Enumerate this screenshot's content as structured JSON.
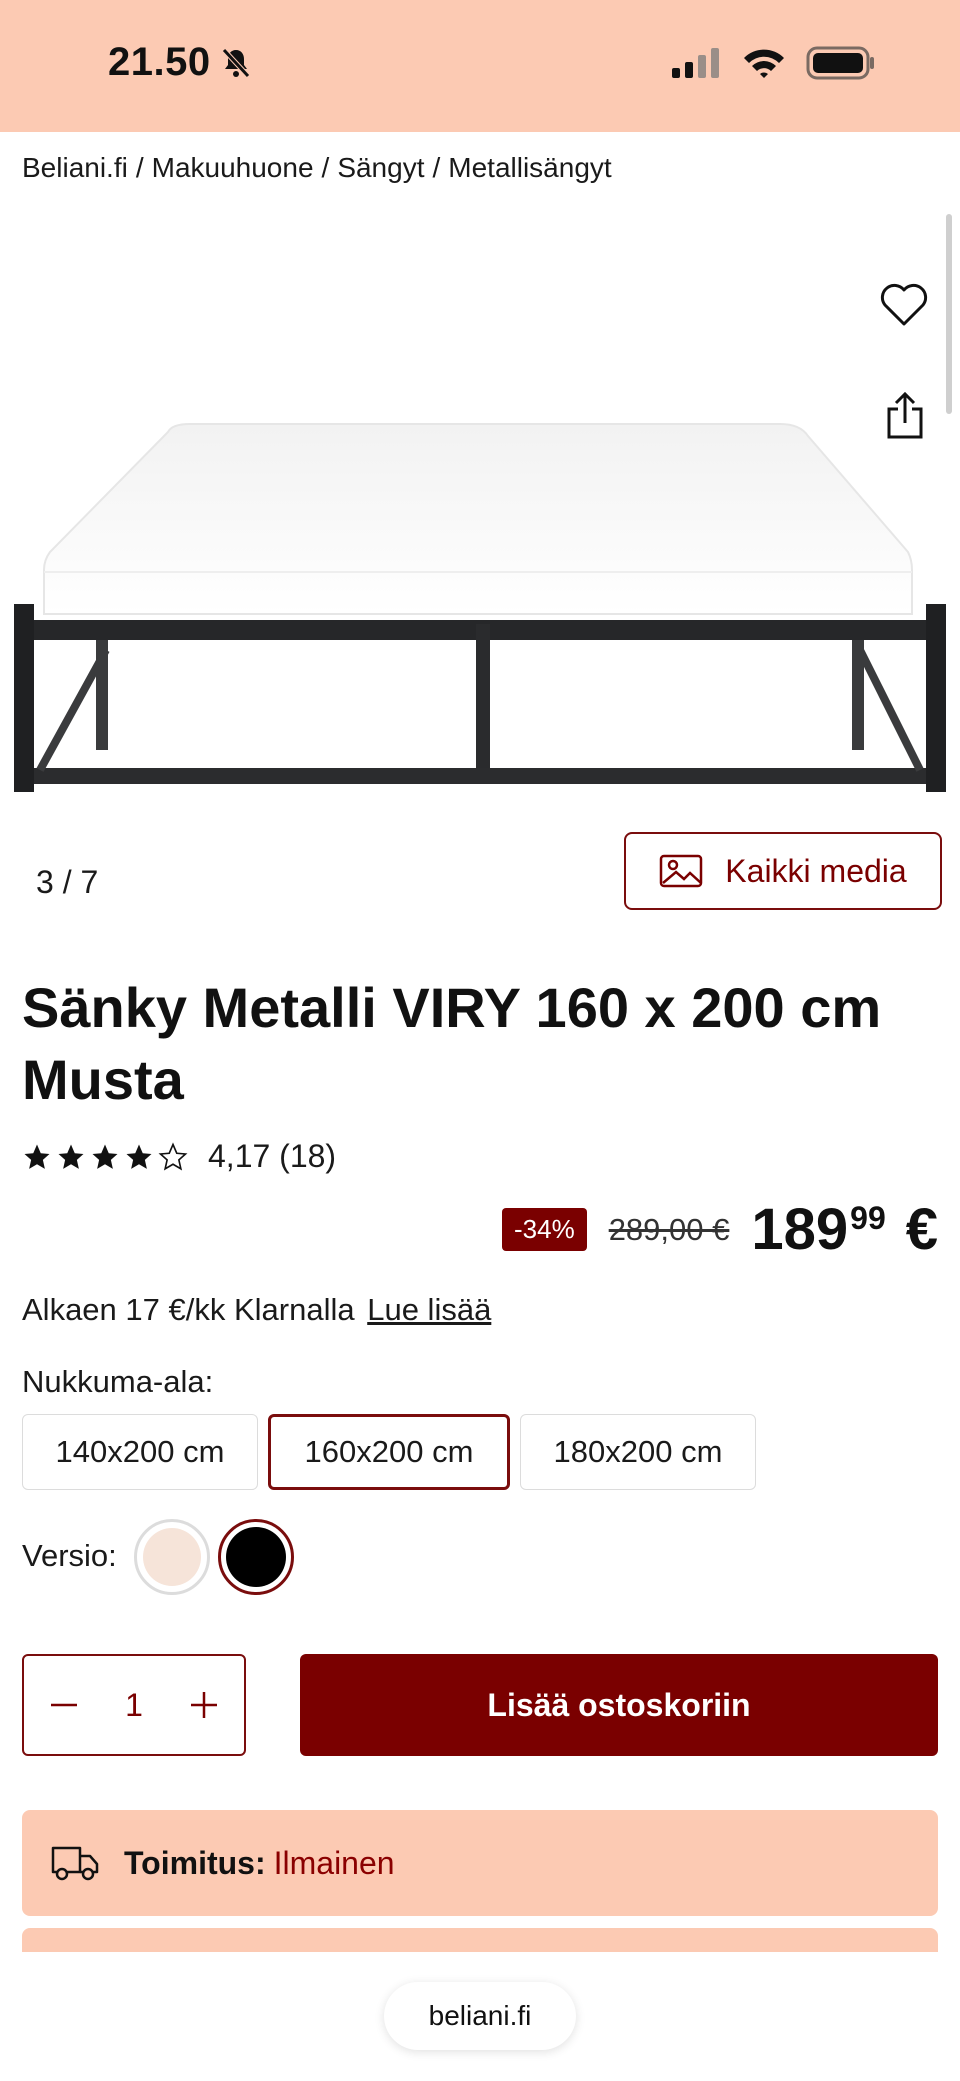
{
  "status_bar": {
    "time": "21.50",
    "background": "#fccab3"
  },
  "breadcrumb": {
    "items": [
      "Beliani.fi",
      "Makuuhuone",
      "Sängyt",
      "Metallisängyt"
    ],
    "separator": "/"
  },
  "gallery": {
    "counter_current": "3",
    "counter_sep": "/",
    "counter_total": "7",
    "all_media_label": "Kaikki media",
    "icons": [
      "heart-icon",
      "share-icon",
      "image-icon"
    ]
  },
  "product": {
    "title": "Sänky Metalli VIRY 160 x 200 cm Musta",
    "rating_value": 4.17,
    "rating_text": "4,17 (18)",
    "stars_filled": 4,
    "stars_total": 5,
    "discount": "-34%",
    "old_price": "289,00 €",
    "price_whole": "189",
    "price_cents": "99",
    "currency": "€",
    "klarna_text": "Alkaen 17 €/kk Klarnalla",
    "klarna_link": "Lue lisää"
  },
  "options": {
    "size_label": "Nukkuma-ala:",
    "sizes": [
      "140x200 cm",
      "160x200 cm",
      "180x200 cm"
    ],
    "selected_size": "160x200 cm",
    "version_label": "Versio:",
    "versions": [
      {
        "name": "beige",
        "color": "#f6e4d9"
      },
      {
        "name": "black",
        "color": "#000000"
      }
    ],
    "selected_version": "black"
  },
  "cart": {
    "quantity": "1",
    "add_label": "Lisää ostoskoriin"
  },
  "delivery": {
    "label": "Toimitus:",
    "value": "Ilmainen"
  },
  "browser": {
    "url": "beliani.fi"
  },
  "colors": {
    "accent": "#7a0000",
    "peach": "#fccab3"
  }
}
